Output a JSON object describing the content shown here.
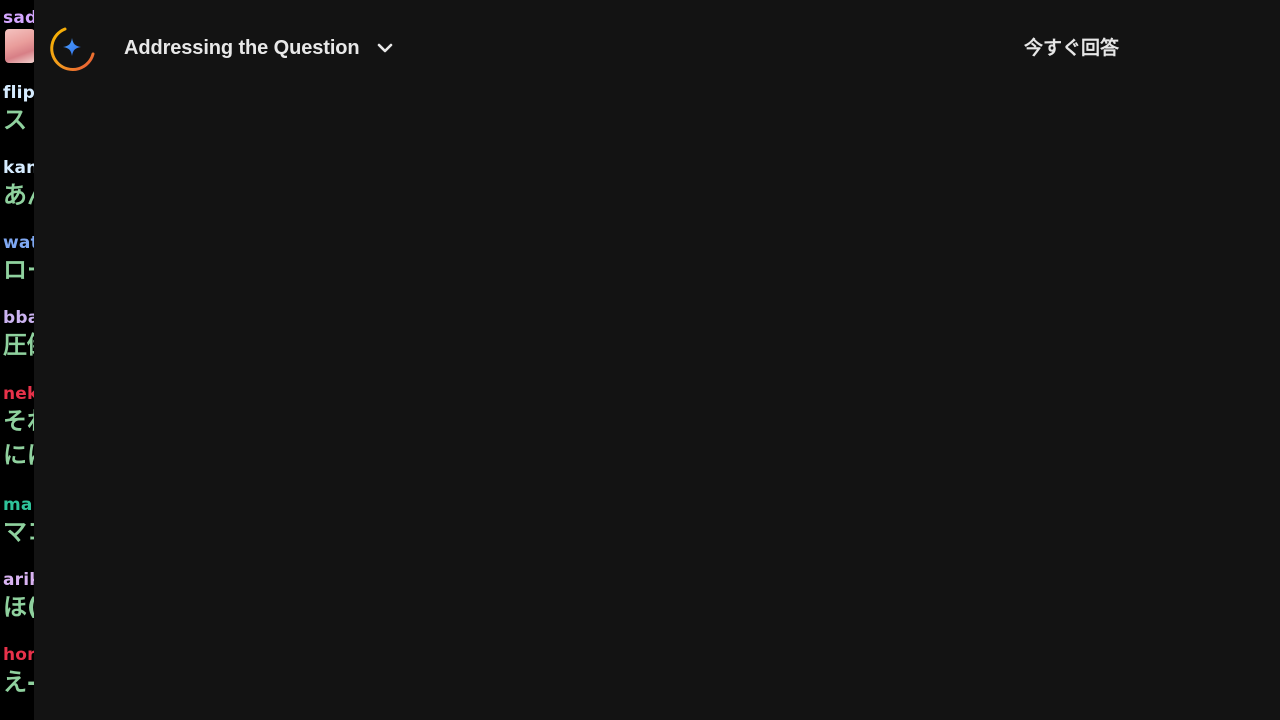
{
  "chat": {
    "messages": [
      {
        "user": "sadc",
        "user_color": "#d4a6ff",
        "text": "",
        "has_avatar": true
      },
      {
        "user": "flip",
        "user_color": "#d6ecff",
        "text": "ス"
      },
      {
        "user": "kan",
        "user_color": "#d6ecff",
        "text": "あん"
      },
      {
        "user": "wat",
        "user_color": "#7fa8f2",
        "text": "ロー"
      },
      {
        "user": "bba",
        "user_color": "#cbb3f0",
        "text": "圧倒"
      },
      {
        "user": "nek",
        "user_color": "#e8324a",
        "text": "それ",
        "text2": "にほ"
      },
      {
        "user": "ma",
        "user_color": "#2fc39a",
        "text": "マコ"
      },
      {
        "user": "arik",
        "user_color": "#d9b3f2",
        "text": "ほ("
      },
      {
        "user": "hor",
        "user_color": "#e8324a",
        "text": "え-"
      }
    ]
  },
  "header": {
    "title": "Addressing the Question",
    "dropdown_icon": "chevron-down-icon",
    "logo_icon": "gemini-spark-icon",
    "answer_now_label": "今すぐ回答"
  },
  "colors": {
    "panel_bg": "#131313",
    "text": "#e8e8e8",
    "chat_text": "#8fd19e"
  }
}
